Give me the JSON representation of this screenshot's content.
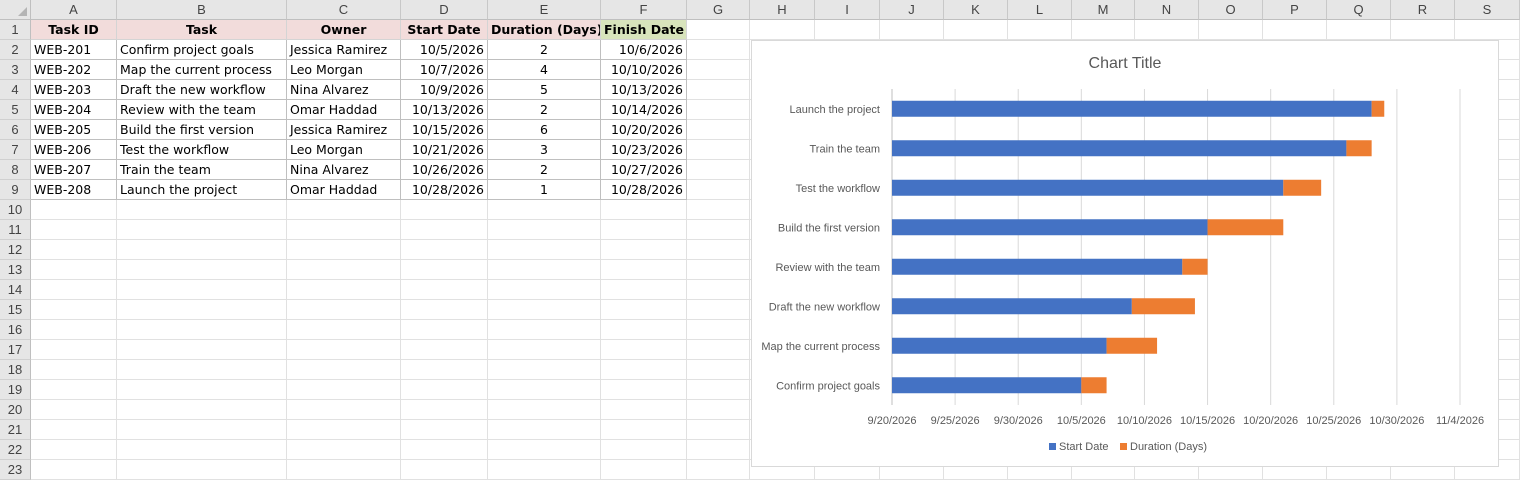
{
  "columns": [
    "A",
    "B",
    "C",
    "D",
    "E",
    "F",
    "G",
    "H",
    "I",
    "J",
    "K",
    "L",
    "M",
    "N",
    "O",
    "P",
    "Q",
    "R",
    "S"
  ],
  "rows": [
    "1",
    "2",
    "3",
    "4",
    "5",
    "6",
    "7",
    "8",
    "9",
    "10",
    "11",
    "12",
    "13",
    "14",
    "15",
    "16",
    "17",
    "18",
    "19",
    "20",
    "21",
    "22",
    "23"
  ],
  "table": {
    "headers": [
      "Task ID",
      "Task",
      "Owner",
      "Start Date",
      "Duration (Days)",
      "Finish Date"
    ],
    "rows": [
      [
        "WEB-201",
        "Confirm project goals",
        "Jessica Ramirez",
        "10/5/2026",
        "2",
        "10/6/2026"
      ],
      [
        "WEB-202",
        "Map the current process",
        "Leo Morgan",
        "10/7/2026",
        "4",
        "10/10/2026"
      ],
      [
        "WEB-203",
        "Draft the new workflow",
        "Nina Alvarez",
        "10/9/2026",
        "5",
        "10/13/2026"
      ],
      [
        "WEB-204",
        "Review with the team",
        "Omar Haddad",
        "10/13/2026",
        "2",
        "10/14/2026"
      ],
      [
        "WEB-205",
        "Build the first version",
        "Jessica Ramirez",
        "10/15/2026",
        "6",
        "10/20/2026"
      ],
      [
        "WEB-206",
        "Test the workflow",
        "Leo Morgan",
        "10/21/2026",
        "3",
        "10/23/2026"
      ],
      [
        "WEB-207",
        "Train the team",
        "Nina Alvarez",
        "10/26/2026",
        "2",
        "10/27/2026"
      ],
      [
        "WEB-208",
        "Launch the project",
        "Omar Haddad",
        "10/28/2026",
        "1",
        "10/28/2026"
      ]
    ]
  },
  "colors": {
    "header_pink": "#f2dcdb",
    "header_green": "#d8e4bc",
    "start_series": "#4472c4",
    "duration_series": "#ed7d31"
  },
  "chart_data": {
    "type": "bar",
    "orientation": "horizontal-stacked",
    "title": "Chart Title",
    "categories": [
      "Launch the project",
      "Train the team",
      "Test the workflow",
      "Build the first version",
      "Review with the team",
      "Draft the new workflow",
      "Map the current process",
      "Confirm project goals"
    ],
    "series": [
      {
        "name": "Start Date",
        "values": [
          "10/28/2026",
          "10/26/2026",
          "10/21/2026",
          "10/15/2026",
          "10/13/2026",
          "10/9/2026",
          "10/7/2026",
          "10/5/2026"
        ]
      },
      {
        "name": "Duration (Days)",
        "values": [
          1,
          2,
          3,
          6,
          2,
          5,
          4,
          2
        ]
      }
    ],
    "xlim": [
      "9/20/2026",
      "11/4/2026"
    ],
    "x_ticks": [
      "9/20/2026",
      "9/25/2026",
      "9/30/2026",
      "10/5/2026",
      "10/10/2026",
      "10/15/2026",
      "10/20/2026",
      "10/25/2026",
      "10/30/2026",
      "11/4/2026"
    ],
    "grid": true,
    "legend": "bottom"
  }
}
